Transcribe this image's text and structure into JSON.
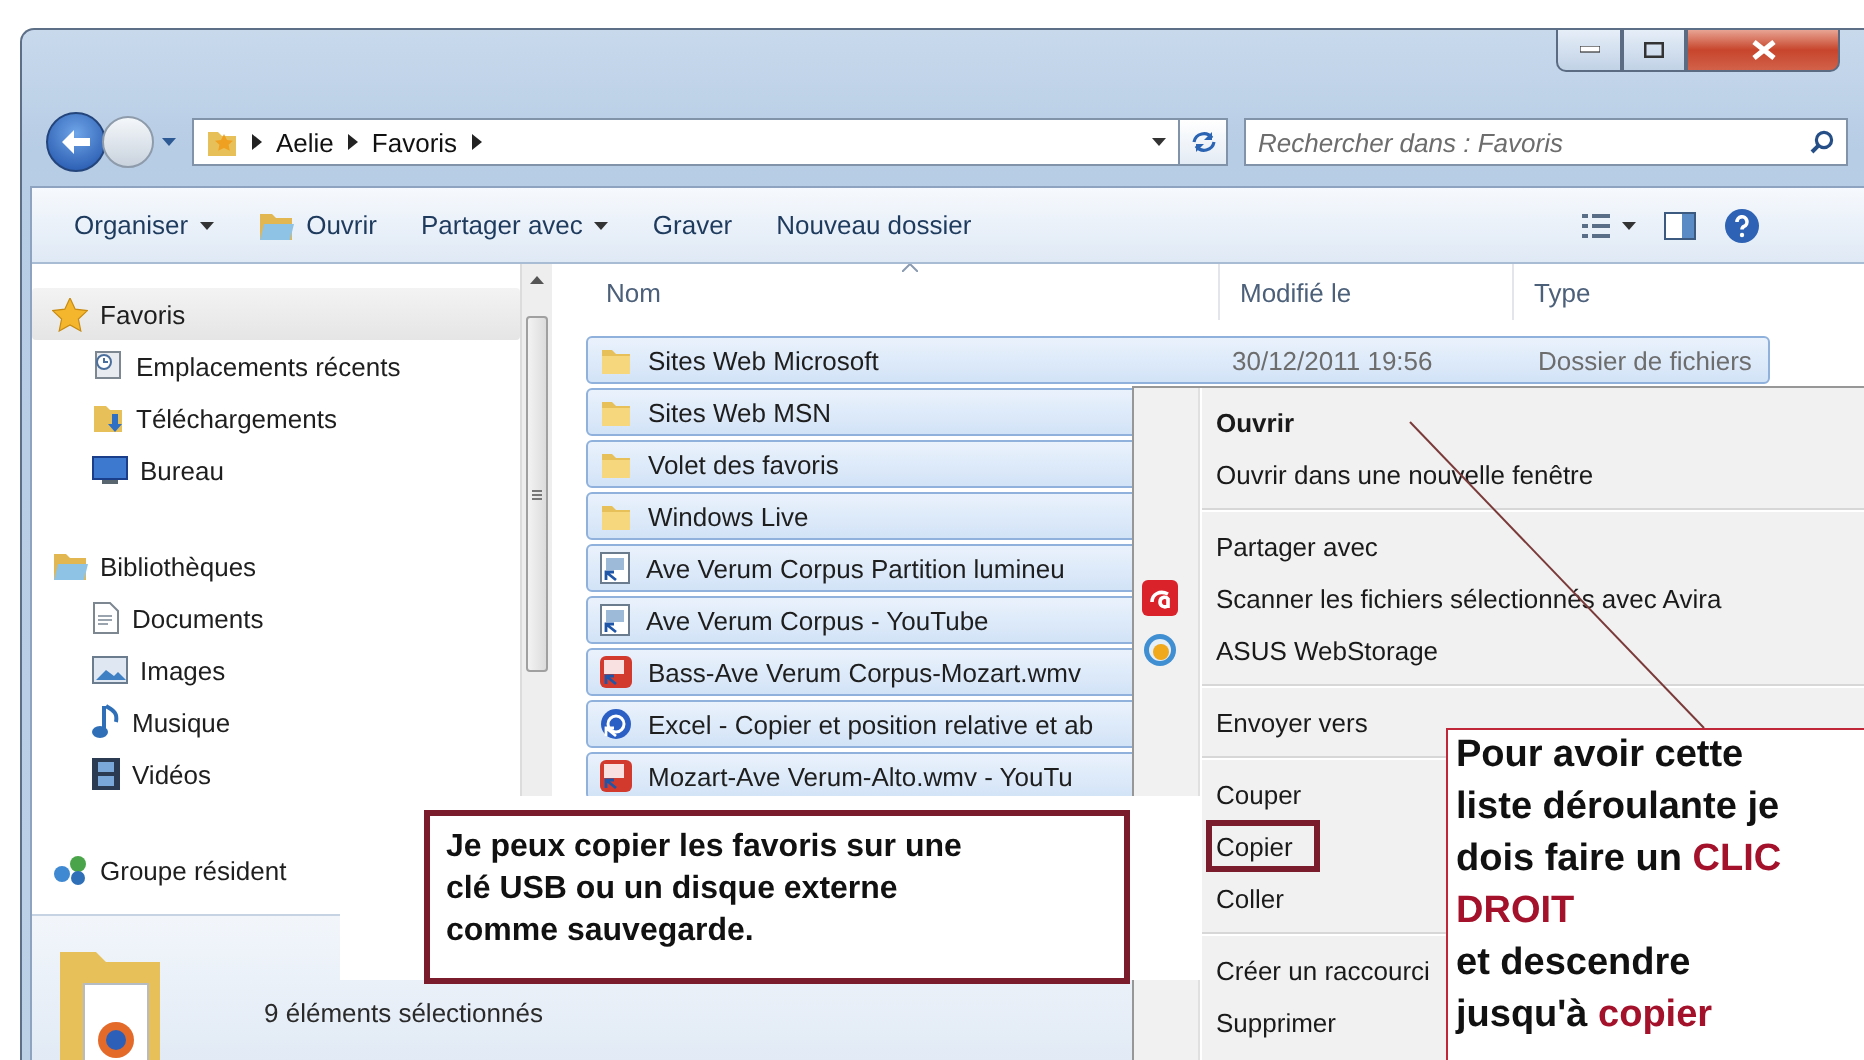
{
  "address_bar": {
    "breadcrumbs": [
      "Aelie",
      "Favoris"
    ]
  },
  "search": {
    "placeholder": "Rechercher dans : Favoris"
  },
  "toolbar": {
    "items": [
      {
        "label": "Organiser",
        "kind": "menu"
      },
      {
        "label": "Ouvrir",
        "kind": "icon"
      },
      {
        "label": "Partager avec",
        "kind": "menu"
      },
      {
        "label": "Graver",
        "kind": "plain"
      },
      {
        "label": "Nouveau dossier",
        "kind": "plain"
      }
    ]
  },
  "navigation": {
    "items": [
      {
        "label": "Favoris",
        "selected": true,
        "children": [
          {
            "label": "Emplacements récents",
            "selected": false
          },
          {
            "label": "Téléchargements",
            "selected": false
          },
          {
            "label": "Bureau",
            "selected": false
          }
        ]
      },
      {
        "label": "Bibliothèques",
        "selected": false,
        "children": [
          {
            "label": "Documents",
            "selected": false
          },
          {
            "label": "Images",
            "selected": false
          },
          {
            "label": "Musique",
            "selected": false
          },
          {
            "label": "Vidéos",
            "selected": false
          }
        ]
      },
      {
        "label": "Groupe résident",
        "selected": false
      }
    ]
  },
  "file_list": {
    "columns": [
      "Nom",
      "Modifié le",
      "Type"
    ],
    "rows": [
      {
        "name": "Sites Web Microsoft",
        "kind": "folder",
        "selected": true,
        "modified": "30/12/2011 19:56",
        "type": "Dossier de fichiers"
      },
      {
        "name": "Sites Web MSN",
        "kind": "folder",
        "selected": true
      },
      {
        "name": "Volet des favoris",
        "kind": "folder",
        "selected": true
      },
      {
        "name": "Windows Live",
        "kind": "folder",
        "selected": true
      },
      {
        "name": "Ave Verum Corpus  Partition lumineu",
        "kind": "page",
        "selected": true
      },
      {
        "name": "Ave Verum Corpus - YouTube",
        "kind": "page",
        "selected": true
      },
      {
        "name": "Bass-Ave Verum Corpus-Mozart.wmv",
        "kind": "video",
        "selected": true
      },
      {
        "name": "Excel - Copier et position relative et ab",
        "kind": "web",
        "selected": true
      },
      {
        "name": "Mozart-Ave Verum-Alto.wmv - YouTu",
        "kind": "video",
        "selected": true
      }
    ]
  },
  "status_bar": {
    "text": "9 éléments sélectionnés"
  },
  "context_menu": {
    "items": [
      {
        "label": "Ouvrir",
        "kind": "plain",
        "default": true,
        "separator_before": false,
        "marked": false
      },
      {
        "label": "Ouvrir dans une nouvelle fenêtre",
        "kind": "plain",
        "default": false,
        "separator_before": false,
        "marked": false
      },
      {
        "label": "Partager avec",
        "kind": "plain",
        "default": false,
        "separator_before": true,
        "marked": false
      },
      {
        "label": "Scanner les fichiers sélectionnés avec Avira",
        "kind": "scan",
        "default": false,
        "separator_before": false,
        "marked": false
      },
      {
        "label": "ASUS WebStorage",
        "kind": "cloud",
        "default": false,
        "separator_before": false,
        "marked": false
      },
      {
        "label": "Envoyer vers",
        "kind": "plain",
        "default": false,
        "separator_before": true,
        "marked": false
      },
      {
        "label": "Couper",
        "kind": "plain",
        "default": false,
        "separator_before": true,
        "marked": false
      },
      {
        "label": "Copier",
        "kind": "plain",
        "default": false,
        "separator_before": false,
        "marked": true
      },
      {
        "label": "Coller",
        "kind": "plain",
        "default": false,
        "separator_before": false,
        "marked": false
      },
      {
        "label": "Créer un raccourci",
        "kind": "plain",
        "default": false,
        "separator_before": true,
        "marked": false
      },
      {
        "label": "Supprimer",
        "kind": "plain",
        "default": false,
        "separator_before": false,
        "marked": false
      }
    ]
  },
  "callouts": [
    {
      "kind": "note",
      "segments": [
        {
          "text": "Je peux copier les favoris sur une\nclé USB ou un disque externe\ncomme sauvegarde.",
          "emphasis": false
        }
      ]
    },
    {
      "kind": "instruction",
      "segments": [
        {
          "text": "Pour avoir cette\nliste déroulante je\ndois faire un ",
          "emphasis": false
        },
        {
          "text": "CLIC\nDROIT",
          "emphasis": true
        },
        {
          "text": "\net descendre\njusqu'à ",
          "emphasis": false
        },
        {
          "text": "copier",
          "emphasis": true
        }
      ]
    }
  ]
}
